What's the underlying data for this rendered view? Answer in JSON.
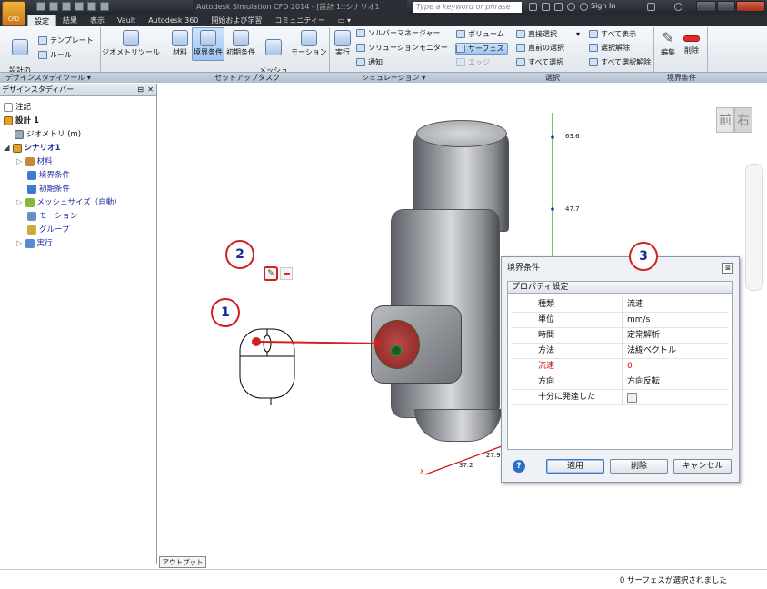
{
  "title_bar": {
    "app_title": "Autodesk Simulation CFD 2014 - [設計 1::シナリオ1",
    "search_placeholder": "Type a keyword or phrase",
    "sign_in": "Sign In"
  },
  "app_button": {
    "label": "CFD"
  },
  "tabs": [
    {
      "label": "設定"
    },
    {
      "label": "結果"
    },
    {
      "label": "表示"
    },
    {
      "label": "Vault"
    },
    {
      "label": "Autodesk 360"
    },
    {
      "label": "開始および学習"
    },
    {
      "label": "コミュニティー"
    }
  ],
  "ribbon": {
    "design_add": "設計の\n追加/更新",
    "template": "テンプレート",
    "rule": "ルール",
    "geometry_tool": "ジオメトリツール",
    "material": "材料",
    "boundary": "境界条件",
    "initial": "初期条件",
    "mesh_size": "メッシュ\nサイズ",
    "motion": "モーション",
    "run": "実行",
    "solver_manager": "ソルバーマネージャー",
    "solution_monitor": "ソリューションモニター",
    "notify": "通知",
    "volume": "ボリューム",
    "surface": "サーフェス",
    "edge": "エッジ",
    "direct_select": "直接選択",
    "prev_select": "直前の選択",
    "select_all": "すべて選択",
    "show_all": "すべて表示",
    "deselect": "選択解除",
    "deselect_all": "すべて選択解除",
    "edit": "編集",
    "delete": "削除"
  },
  "panels": {
    "design_study_tools": "デザインスタディツール ▾",
    "setup_tasks": "セットアップタスク",
    "simulation": "シミュレーション ▾",
    "selection": "選択",
    "boundary": "境界条件"
  },
  "browser": {
    "header": "デザインスタディバー",
    "items": [
      {
        "label": "注記"
      },
      {
        "label": "設計 1"
      },
      {
        "label": "ジオメトリ (m)"
      },
      {
        "label": "シナリオ1"
      },
      {
        "label": "材料"
      },
      {
        "label": "境界条件"
      },
      {
        "label": "初期条件"
      },
      {
        "label": "メッシュサイズ（自動）"
      },
      {
        "label": "モーション"
      },
      {
        "label": "グループ"
      },
      {
        "label": "実行"
      }
    ]
  },
  "viewcube": {
    "front": "前",
    "right": "右"
  },
  "axis_labels": {
    "y_top": "63.6",
    "y_mid": "47.7",
    "x_1": "27.9",
    "x_2": "37.2",
    "x_axis": "X"
  },
  "callouts": {
    "c1": "1",
    "c2": "2",
    "c3": "3"
  },
  "dialog": {
    "title": "境界条件",
    "group_label": "プロパティ設定",
    "rows": [
      {
        "key": "種類",
        "value": "流速"
      },
      {
        "key": "単位",
        "value": "mm/s"
      },
      {
        "key": "時間",
        "value": "定常解析"
      },
      {
        "key": "方法",
        "value": "法線ベクトル"
      },
      {
        "key": "流速",
        "value": "0"
      },
      {
        "key": "方向",
        "value": "方向反転"
      },
      {
        "key": "十分に発達した",
        "value": ""
      }
    ],
    "apply": "適用",
    "delete": "削除",
    "cancel": "キャンセル",
    "help": "?"
  },
  "output_bar": "アウトプットバー",
  "status_text": "0 サーフェスが選択されました",
  "colors": {
    "accent": "#d12020",
    "callout_text": "#1a2a9a",
    "axis_green": "#1a9a1a",
    "axis_red": "#cc1010",
    "axis_blue": "#2a2ab0"
  }
}
